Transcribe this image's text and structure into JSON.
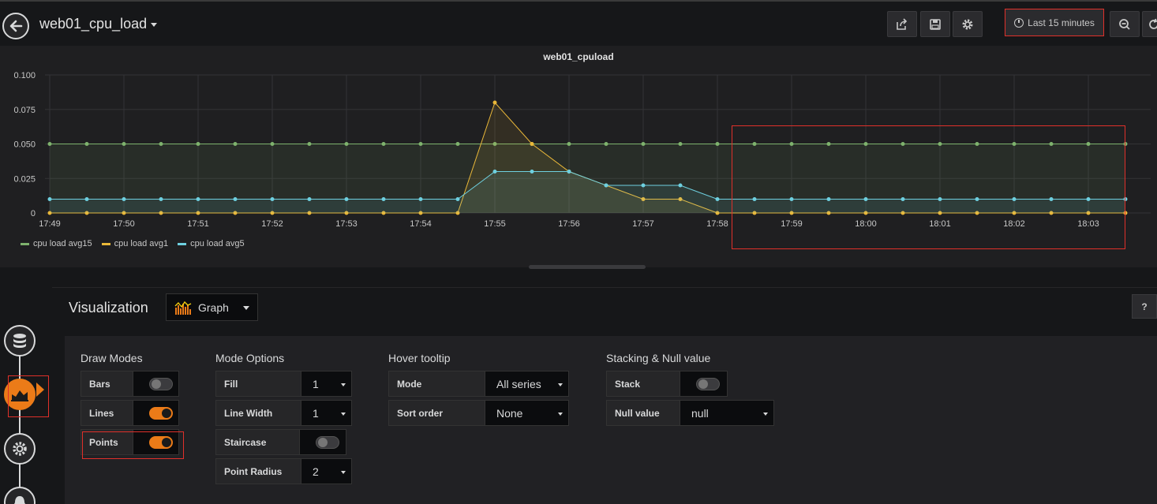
{
  "dashboard": {
    "title": "web01_cpu_load"
  },
  "topbar": {
    "time_range": "Last 15 minutes"
  },
  "panel": {
    "title": "web01_cpuload",
    "legend": [
      {
        "name": "cpu load avg15",
        "color": "#7eb26d"
      },
      {
        "name": "cpu load avg1",
        "color": "#eab839"
      },
      {
        "name": "cpu load avg5",
        "color": "#6ed0e0"
      }
    ]
  },
  "chart_data": {
    "type": "line",
    "title": "web01_cpuload",
    "x_ticks": [
      "17:49",
      "17:50",
      "17:51",
      "17:52",
      "17:53",
      "17:54",
      "17:55",
      "17:56",
      "17:57",
      "17:58",
      "17:59",
      "18:00",
      "18:01",
      "18:02",
      "18:03"
    ],
    "y_ticks": [
      "0.100",
      "0.075",
      "0.050",
      "0.025",
      "0"
    ],
    "ylim": [
      0,
      0.1
    ],
    "xlim": [
      "17:49",
      "18:03:30"
    ],
    "grid": true,
    "legend_position": "bottom-left",
    "x": [
      "17:49",
      "17:49:30",
      "17:50",
      "17:50:30",
      "17:51",
      "17:51:30",
      "17:52",
      "17:52:30",
      "17:53",
      "17:53:30",
      "17:54",
      "17:54:30",
      "17:55",
      "17:55:30",
      "17:56",
      "17:56:30",
      "17:57",
      "17:57:30",
      "17:58",
      "17:58:30",
      "17:59",
      "17:59:30",
      "18:00",
      "18:00:30",
      "18:01",
      "18:01:30",
      "18:02",
      "18:02:30",
      "18:03",
      "18:03:30"
    ],
    "series": [
      {
        "name": "cpu load avg15",
        "color": "#7eb26d",
        "values": [
          0.05,
          0.05,
          0.05,
          0.05,
          0.05,
          0.05,
          0.05,
          0.05,
          0.05,
          0.05,
          0.05,
          0.05,
          0.05,
          0.05,
          0.05,
          0.05,
          0.05,
          0.05,
          0.05,
          0.05,
          0.05,
          0.05,
          0.05,
          0.05,
          0.05,
          0.05,
          0.05,
          0.05,
          0.05,
          0.05
        ]
      },
      {
        "name": "cpu load avg1",
        "color": "#eab839",
        "values": [
          0,
          0,
          0,
          0,
          0,
          0,
          0,
          0,
          0,
          0,
          0,
          0,
          0.08,
          0.05,
          0.03,
          0.02,
          0.01,
          0.01,
          0,
          0,
          0,
          0,
          0,
          0,
          0,
          0,
          0,
          0,
          0,
          0
        ]
      },
      {
        "name": "cpu load avg5",
        "color": "#6ed0e0",
        "values": [
          0.01,
          0.01,
          0.01,
          0.01,
          0.01,
          0.01,
          0.01,
          0.01,
          0.01,
          0.01,
          0.01,
          0.01,
          0.03,
          0.03,
          0.03,
          0.02,
          0.02,
          0.02,
          0.01,
          0.01,
          0.01,
          0.01,
          0.01,
          0.01,
          0.01,
          0.01,
          0.01,
          0.01,
          0.01,
          0.01
        ]
      }
    ]
  },
  "editor": {
    "visualization_label": "Visualization",
    "visualization_value": "Graph",
    "help_label": "?",
    "draw_modes": {
      "title": "Draw Modes",
      "bars": {
        "label": "Bars",
        "on": false
      },
      "lines": {
        "label": "Lines",
        "on": true
      },
      "points": {
        "label": "Points",
        "on": true
      }
    },
    "mode_options": {
      "title": "Mode Options",
      "fill": {
        "label": "Fill",
        "value": "1"
      },
      "line_width": {
        "label": "Line Width",
        "value": "1"
      },
      "staircase": {
        "label": "Staircase",
        "on": false
      },
      "point_radius": {
        "label": "Point Radius",
        "value": "2"
      }
    },
    "hover_tooltip": {
      "title": "Hover tooltip",
      "mode": {
        "label": "Mode",
        "value": "All series"
      },
      "sort_order": {
        "label": "Sort order",
        "value": "None"
      }
    },
    "stacking": {
      "title": "Stacking & Null value",
      "stack": {
        "label": "Stack",
        "on": false
      },
      "null_value": {
        "label": "Null value",
        "value": "null"
      }
    }
  }
}
